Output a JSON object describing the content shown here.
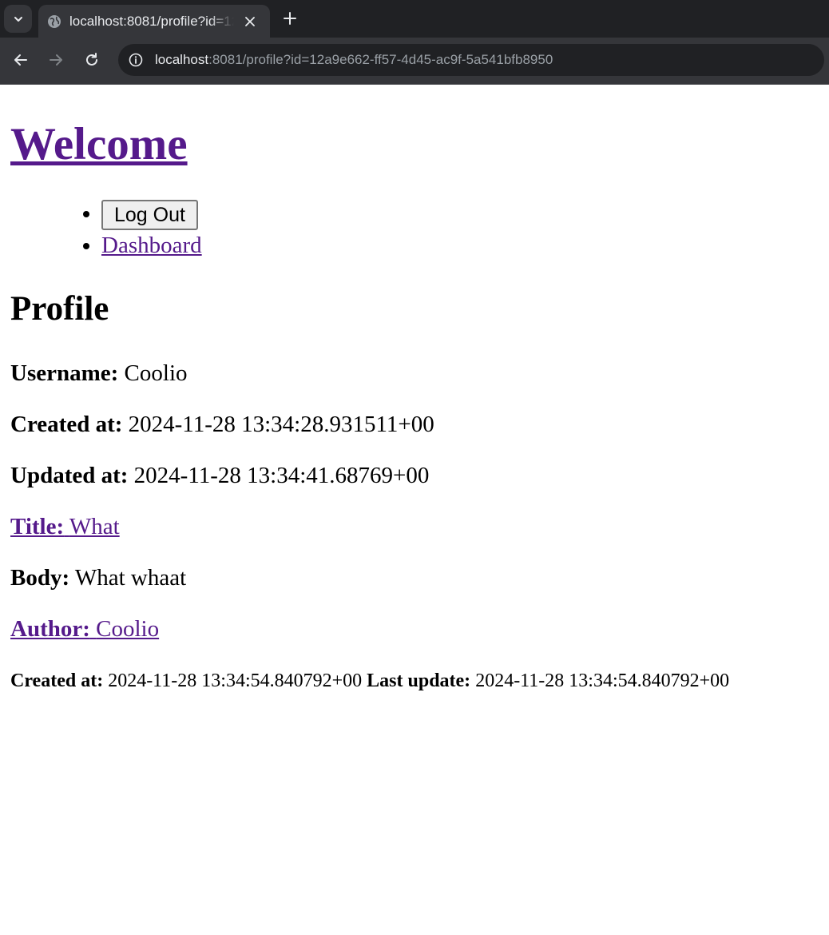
{
  "browser": {
    "tab_title": "localhost:8081/profile?id=12a9e662-ff57-4d45-ac9f-5a541bfb8950",
    "url_host": "localhost",
    "url_rest": ":8081/profile?id=12a9e662-ff57-4d45-ac9f-5a541bfb8950",
    "icons": [
      "chevron-down-icon",
      "globe-icon",
      "close-icon",
      "plus-icon",
      "back-arrow-icon",
      "forward-arrow-icon",
      "reload-icon",
      "info-icon"
    ]
  },
  "header": {
    "title": "Welcome"
  },
  "nav": {
    "logout_label": "Log Out",
    "dashboard_label": "Dashboard"
  },
  "profile": {
    "heading": "Profile",
    "username_label": "Username:",
    "username": "Coolio",
    "created_label": "Created at:",
    "created": "2024-11-28 13:34:28.931511+00",
    "updated_label": "Updated at:",
    "updated": "2024-11-28 13:34:41.68769+00"
  },
  "post": {
    "title_label": "Title:",
    "title": "What",
    "body_label": "Body:",
    "body": "What whaat",
    "author_label": "Author:",
    "author": "Coolio",
    "created_label": "Created at:",
    "created": "2024-11-28 13:34:54.840792+00",
    "updated_label": "Last update:",
    "updated": "2024-11-28 13:34:54.840792+00"
  },
  "colors": {
    "link": "#551a8b",
    "chrome_dark": "#202124",
    "chrome_mid": "#35363a"
  }
}
